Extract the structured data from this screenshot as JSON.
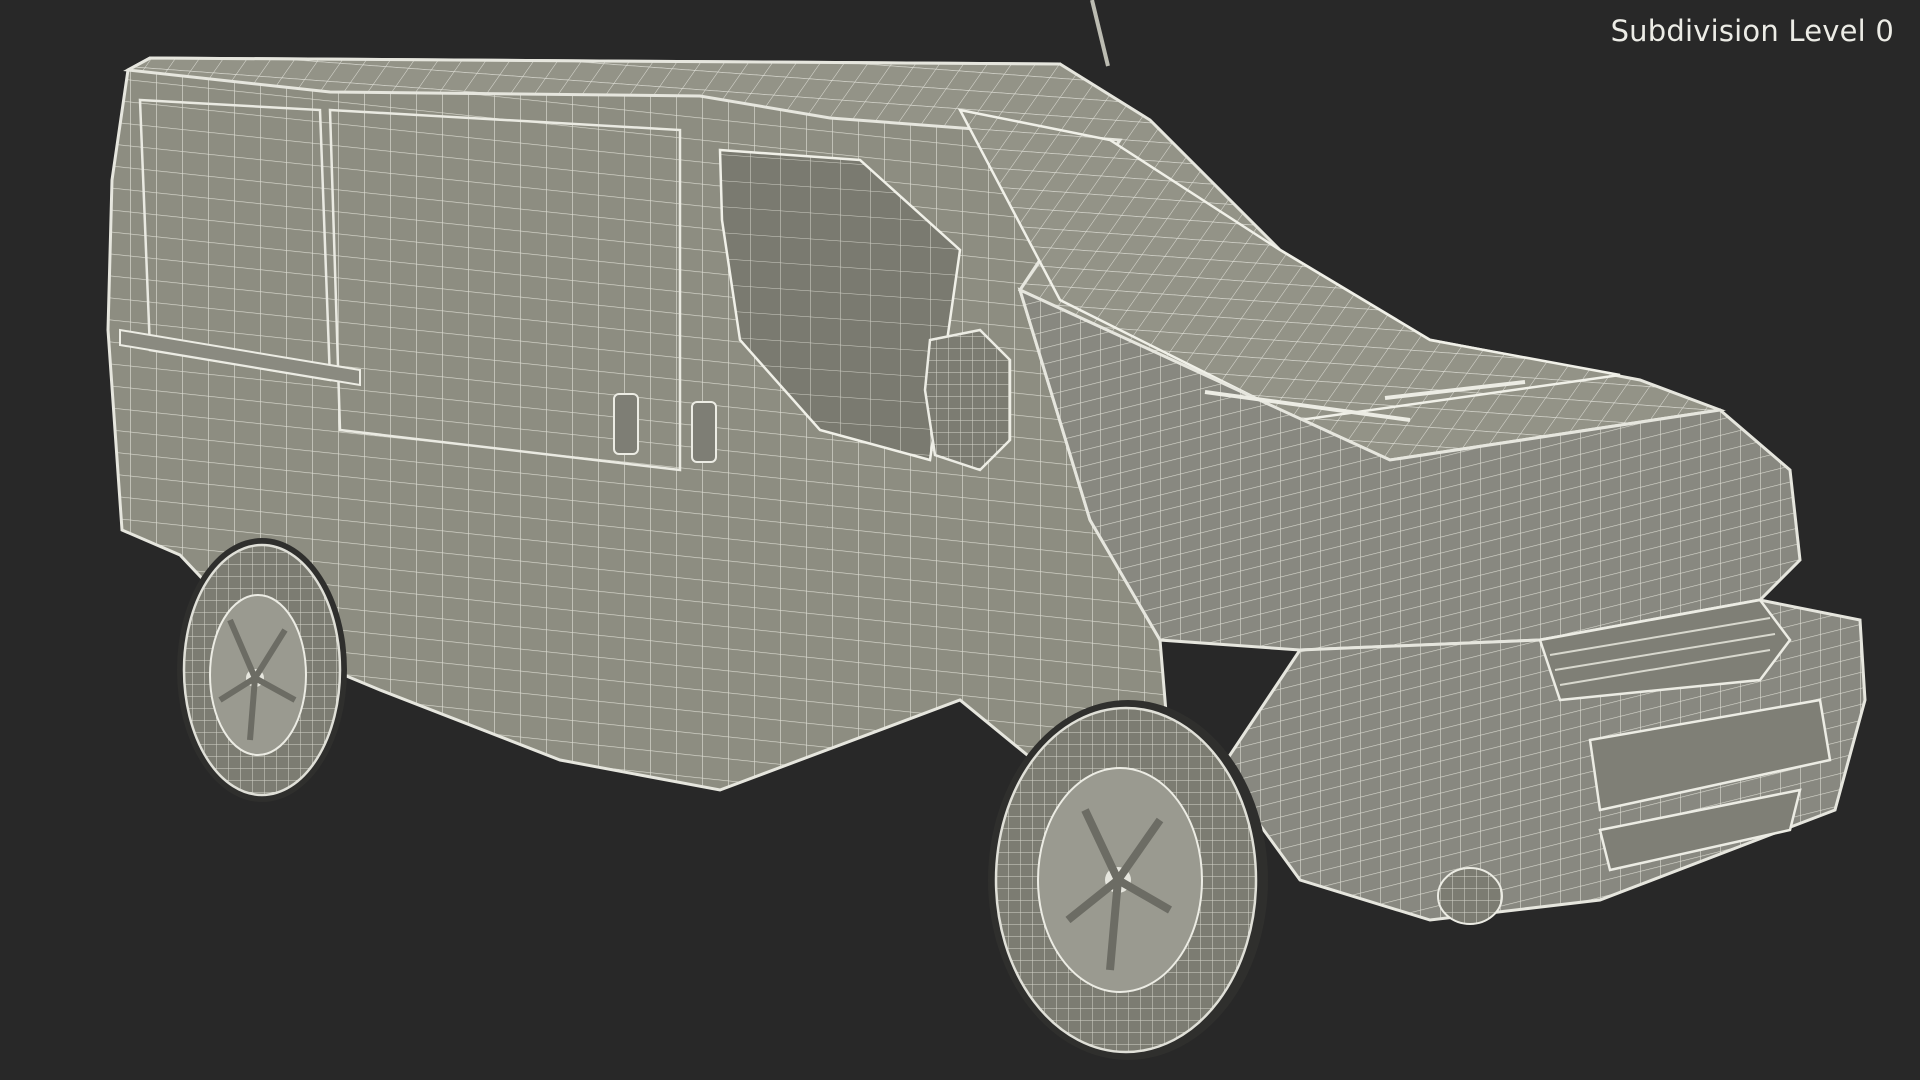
{
  "viewport": {
    "subdivision_label": "Subdivision Level 0",
    "background_color": "#282828",
    "mesh_fill_color": "#8d8d81",
    "wire_color": "#e4e4dc",
    "subject": "wireframe-van-3d-model"
  }
}
